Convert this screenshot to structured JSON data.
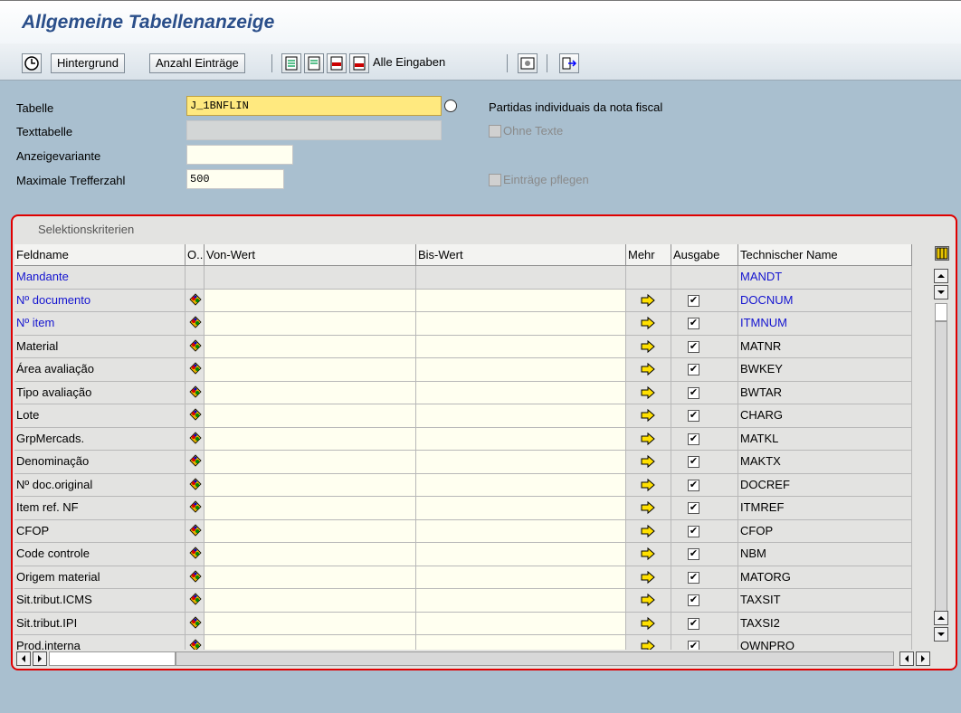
{
  "app": {
    "title": "Allgemeine Tabellenanzeige"
  },
  "toolbar": {
    "execute_icon": "execute-clock-icon",
    "hintergrund": "Hintergrund",
    "anzahl": "Anzahl Einträge",
    "alle_eingaben": "Alle Eingaben"
  },
  "form": {
    "tabelle_label": "Tabelle",
    "tabelle_value": "J_1BNFLIN",
    "tabelle_desc": "Partidas individuais da nota fiscal",
    "texttabelle_label": "Texttabelle",
    "ohne_texte": "Ohne Texte",
    "anzeigevariante_label": "Anzeigevariante",
    "anzeigevariante_value": "",
    "max_label": "Maximale Trefferzahl",
    "max_value": "500",
    "eintraege_pflegen": "Einträge pflegen"
  },
  "section": {
    "title": "Selektionskriterien"
  },
  "table": {
    "headers": {
      "feldname": "Feldname",
      "o": "O..",
      "von": "Von-Wert",
      "bis": "Bis-Wert",
      "mehr": "Mehr",
      "ausgabe": "Ausgabe",
      "tech": "Technischer Name"
    },
    "rows": [
      {
        "name": "Mandante",
        "tech": "MANDT",
        "key": true,
        "editable": false
      },
      {
        "name": "Nº documento",
        "tech": "DOCNUM",
        "key": true,
        "editable": true
      },
      {
        "name": "Nº item",
        "tech": "ITMNUM",
        "key": true,
        "editable": true
      },
      {
        "name": "Material",
        "tech": "MATNR",
        "key": false,
        "editable": true
      },
      {
        "name": "Área avaliação",
        "tech": "BWKEY",
        "key": false,
        "editable": true
      },
      {
        "name": "Tipo avaliação",
        "tech": "BWTAR",
        "key": false,
        "editable": true
      },
      {
        "name": "Lote",
        "tech": "CHARG",
        "key": false,
        "editable": true
      },
      {
        "name": "GrpMercads.",
        "tech": "MATKL",
        "key": false,
        "editable": true
      },
      {
        "name": "Denominação",
        "tech": "MAKTX",
        "key": false,
        "editable": true
      },
      {
        "name": "Nº doc.original",
        "tech": "DOCREF",
        "key": false,
        "editable": true
      },
      {
        "name": "Item ref. NF",
        "tech": "ITMREF",
        "key": false,
        "editable": true
      },
      {
        "name": "CFOP",
        "tech": "CFOP",
        "key": false,
        "editable": true
      },
      {
        "name": "Code controle",
        "tech": "NBM",
        "key": false,
        "editable": true
      },
      {
        "name": "Origem material",
        "tech": "MATORG",
        "key": false,
        "editable": true
      },
      {
        "name": "Sit.tribut.ICMS",
        "tech": "TAXSIT",
        "key": false,
        "editable": true
      },
      {
        "name": "Sit.tribut.IPI",
        "tech": "TAXSI2",
        "key": false,
        "editable": true
      },
      {
        "name": "Prod.interna",
        "tech": "OWNPRO",
        "key": false,
        "editable": true
      }
    ]
  },
  "colors": {
    "key_field": "#1414d0",
    "highlight_frame": "#e00000",
    "input_bg": "#fffff0"
  }
}
